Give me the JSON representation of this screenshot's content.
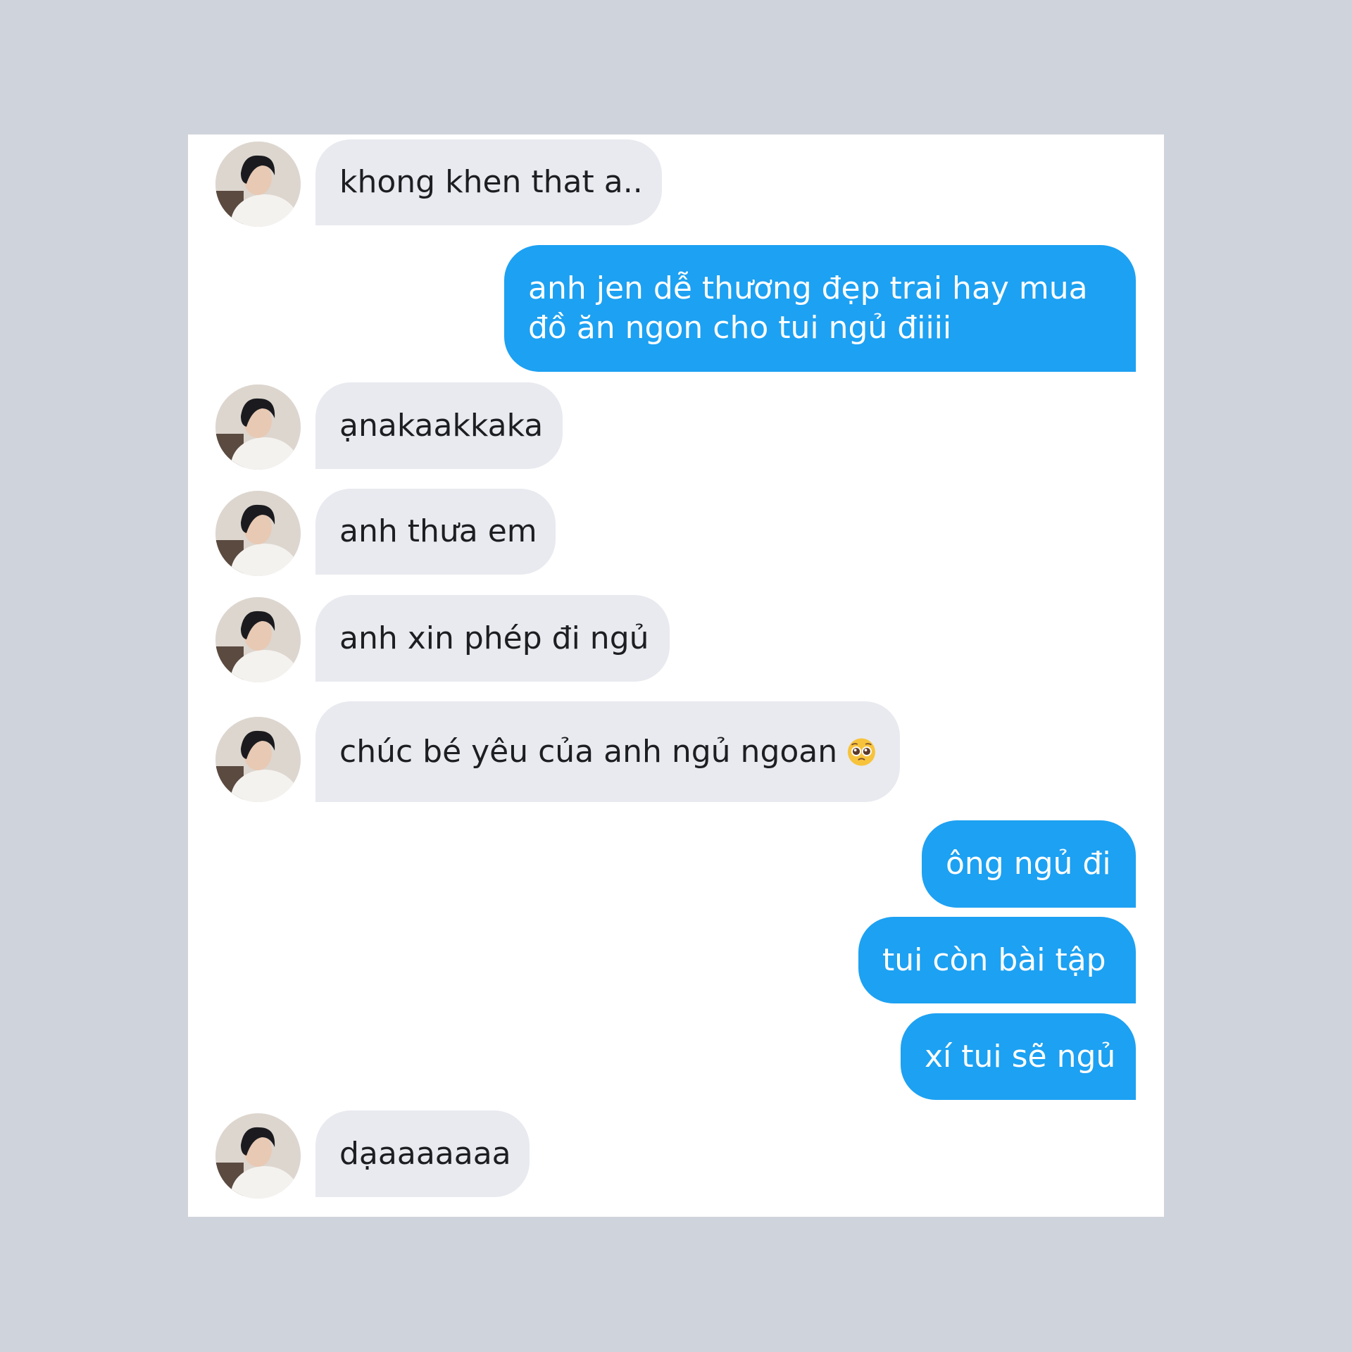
{
  "messages": [
    {
      "from": "them",
      "text": "khong khen that a.."
    },
    {
      "from": "me",
      "text": "anh jen dễ thương đẹp trai hay mua đồ ăn ngon cho tui ngủ điiii"
    },
    {
      "from": "them",
      "text": "ạnakaakkaka"
    },
    {
      "from": "them",
      "text": "anh thưa em"
    },
    {
      "from": "them",
      "text": "anh xin phép đi ngủ"
    },
    {
      "from": "them",
      "text": "chúc bé yêu của anh ngủ ngoan",
      "emoji": "pleading-face-icon"
    },
    {
      "from": "me",
      "text": "ông ngủ đi"
    },
    {
      "from": "me",
      "text": "tui còn bài tập"
    },
    {
      "from": "me",
      "text": "xí tui sẽ ngủ"
    },
    {
      "from": "them",
      "text": "dạaaaaaaa"
    }
  ],
  "colors": {
    "background": "#cfd3dc",
    "panel": "#ffffff",
    "incoming_bubble": "#e9eaef",
    "outgoing_bubble": "#1da1f2"
  }
}
